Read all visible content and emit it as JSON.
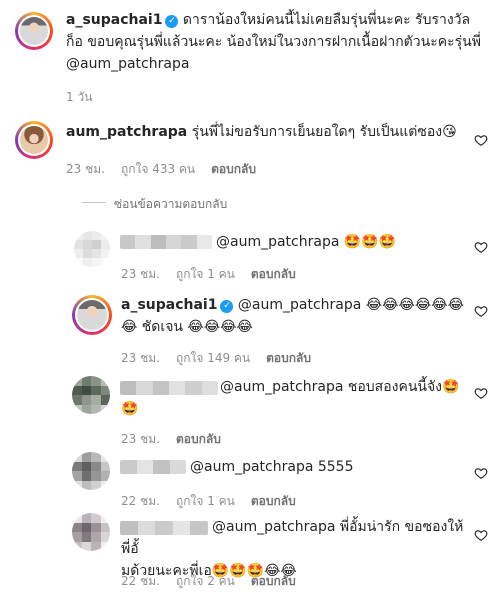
{
  "main_comment": {
    "username": "a_supachai1",
    "text": "ดาราน้องใหม่คนนี้ไม่เคยลืมรุ่นพี่นะคะ รับรางวัลก็อ ขอบคุณรุ่นพี่แล้วนะคะ น้องใหม่ในวงการฝากเนื้อฝากตัวนะคะรุ่นพี่",
    "mention": "@aum_patchrapa",
    "time": "1 วัน"
  },
  "reply_main": {
    "username": "aum_patchrapa",
    "text": "รุ่นพี่ไม่ขอรับการเย็นยอใดๆ รับเป็นแต่ซอง😘",
    "time": "23 ชม.",
    "likes": "ถูกใจ 433 คน",
    "reply_label": "ตอบกลับ"
  },
  "hide_replies_label": "ซ่อนข้อความตอบกลับ",
  "replies": [
    {
      "text": "@aum_patchrapa 🤩🤩🤩",
      "time": "23 ชม.",
      "likes": "ถูกใจ 1 คน",
      "reply_label": "ตอบกลับ"
    },
    {
      "username": "a_supachai1",
      "line1": "@aum_patchrapa 😂😂😂😂😂😂",
      "line2": "😂 ชัดเจน 😂😂😂😂",
      "time": "23 ชม.",
      "likes": "ถูกใจ 149 คน",
      "reply_label": "ตอบกลับ"
    },
    {
      "line1": "@aum_patchrapa ชอบสองคนนี้จัง🤩",
      "line2": "🤩",
      "time": "23 ชม.",
      "reply_label": "ตอบกลับ"
    },
    {
      "text": "@aum_patchrapa 5555",
      "time": "22 ชม.",
      "likes": "ถูกใจ 1 คน",
      "reply_label": "ตอบกลับ"
    },
    {
      "line1": "@aum_patchrapa พี่อั้มน่ารัก ขอซองให้พี่อั้",
      "line2": "มด้วยนะคะพี่เอ🤩🤩🤩😂😂",
      "time": "22 ชม.",
      "likes": "ถูกใจ 2 คน",
      "reply_label": "ตอบกลับ"
    }
  ],
  "icons": {
    "verified": "verified-badge-icon",
    "like": "heart-outline-icon"
  }
}
